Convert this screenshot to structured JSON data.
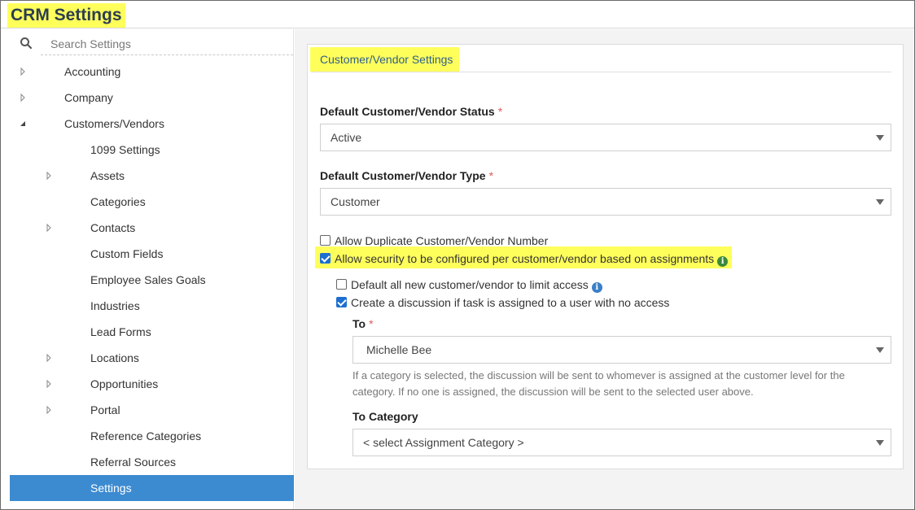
{
  "app": {
    "title": "CRM Settings"
  },
  "sidebar": {
    "search_placeholder": "Search Settings",
    "items": [
      {
        "label": "Accounting",
        "expander": "collapsed"
      },
      {
        "label": "Company",
        "expander": "collapsed"
      },
      {
        "label": "Customers/Vendors",
        "expander": "expanded"
      },
      {
        "label": "1099 Settings",
        "expander": "none"
      },
      {
        "label": "Assets",
        "expander": "collapsed"
      },
      {
        "label": "Categories",
        "expander": "none"
      },
      {
        "label": "Contacts",
        "expander": "collapsed"
      },
      {
        "label": "Custom Fields",
        "expander": "none"
      },
      {
        "label": "Employee Sales Goals",
        "expander": "none"
      },
      {
        "label": "Industries",
        "expander": "none"
      },
      {
        "label": "Lead Forms",
        "expander": "none"
      },
      {
        "label": "Locations",
        "expander": "collapsed"
      },
      {
        "label": "Opportunities",
        "expander": "collapsed"
      },
      {
        "label": "Portal",
        "expander": "collapsed"
      },
      {
        "label": "Reference Categories",
        "expander": "none"
      },
      {
        "label": "Referral Sources",
        "expander": "none"
      },
      {
        "label": "Settings",
        "expander": "none",
        "selected": true
      }
    ]
  },
  "panel": {
    "title": "Customer/Vendor Settings",
    "status": {
      "label": "Default Customer/Vendor Status",
      "required": "*",
      "value": "Active"
    },
    "type": {
      "label": "Default Customer/Vendor Type",
      "required": "*",
      "value": "Customer"
    },
    "allow_duplicate": {
      "label": "Allow Duplicate Customer/Vendor Number",
      "checked": false
    },
    "allow_security": {
      "label": "Allow security to be configured per customer/vendor based on assignments",
      "checked": true,
      "info": "i"
    },
    "default_limit": {
      "label": "Default all new customer/vendor to limit access",
      "checked": false,
      "info": "i"
    },
    "create_discussion": {
      "label": "Create a discussion if task is assigned to a user with no access",
      "checked": true
    },
    "to": {
      "label": "To",
      "required": "*",
      "value": "Michelle Bee"
    },
    "help": {
      "line1": "If a category is selected, the discussion will be sent to whomever is assigned at the customer level for the",
      "line2": "category. If no one is assigned, the discussion will be sent to the selected user above."
    },
    "to_category": {
      "label": "To Category",
      "value": "< select Assignment Category >"
    }
  },
  "colors": {
    "highlight": "#ffff5c",
    "selected": "#3c8bd1",
    "checkbox": "#1d6fd1",
    "required": "#e05a5a"
  }
}
